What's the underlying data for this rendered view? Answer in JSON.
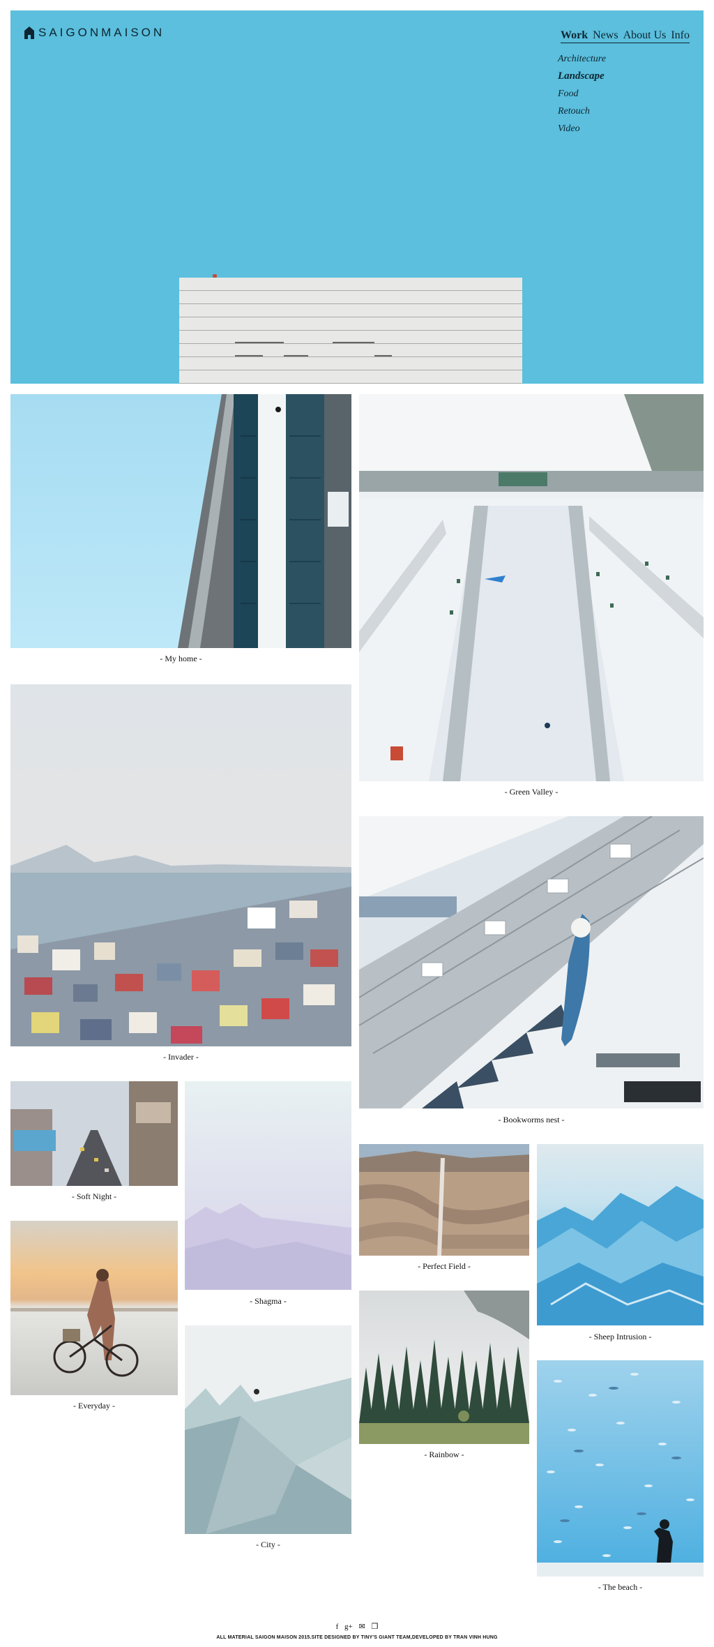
{
  "brand": {
    "name": "SAIGONMAISON"
  },
  "nav": {
    "items": [
      "Work",
      "News",
      "About Us",
      "Info"
    ],
    "active": "Work"
  },
  "subnav": {
    "items": [
      "Architecture",
      "Landscape",
      "Food",
      "Retouch",
      "Video"
    ],
    "active": "Landscape"
  },
  "gallery": {
    "my_home": "- My home -",
    "green_valley": "- Green Valley -",
    "invader": "- Invader -",
    "bookworms_nest": "- Bookworms nest -",
    "soft_night": "- Soft Night -",
    "shagma": "- Shagma -",
    "everyday": "- Everyday -",
    "city": "- City -",
    "perfect_field": "- Perfect Field -",
    "sheep_intrusion": "- Sheep Intrusion -",
    "rainbow": "- Rainbow -",
    "the_beach": "- The beach -"
  },
  "footer": {
    "social_icons": [
      "facebook-icon",
      "google-plus-icon",
      "mail-icon",
      "book-icon"
    ],
    "social_glyphs": [
      "f",
      "g+",
      "✉",
      "❒"
    ],
    "credit": "ALL MATERIAL SAIGON MAISON 2015.SITE DESIGNED BY TINY'S GIANT TEAM,DEVELOPED BY TRAN VINH HUNG"
  },
  "colors": {
    "hero_sky": "#5bbfdd",
    "text_dark": "#0d2531"
  }
}
